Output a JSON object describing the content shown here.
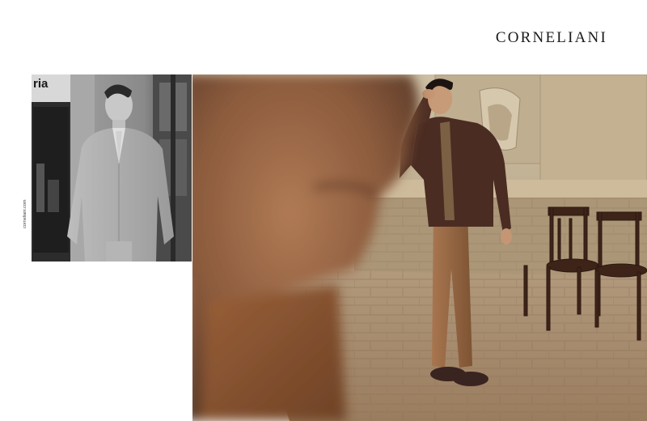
{
  "brand": {
    "name": "CORNELIANI"
  },
  "side_caption": {
    "text": "corneliani.com"
  },
  "bw_photo": {
    "sign_text": "ria"
  },
  "colors": {
    "background": "#ffffff",
    "brand_text": "#1a1a1a",
    "wall": "#c9b89b",
    "paving": "#a5886b",
    "jacket": "#4a2c22",
    "trousers": "#9a6a43"
  }
}
